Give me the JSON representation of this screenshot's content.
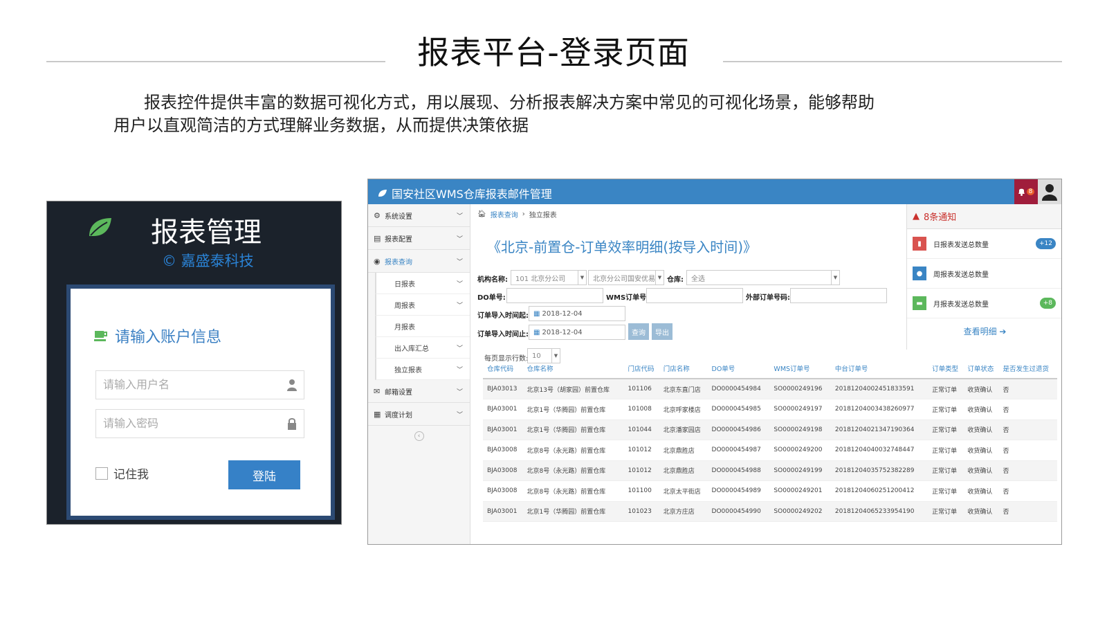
{
  "slide": {
    "title": "报表平台-登录页面",
    "intro_line1": "报表控件提供丰富的数据可视化方式，用以展现、分析报表解决方案中常见的可视化场景，能够帮助",
    "intro_line2": "用户以直观简洁的方式理解业务数据，从而提供决策依据"
  },
  "login": {
    "title": "报表管理",
    "company": "© 嘉盛泰科技",
    "hint": "请输入账户信息",
    "username_placeholder": "请输入用户名",
    "password_placeholder": "请输入密码",
    "remember": "记住我",
    "submit": "登陆",
    "colors": {
      "bg": "#1b222b",
      "accent": "#3681c7",
      "leaf": "#5cb85c"
    }
  },
  "app": {
    "title": "国安社区WMS仓库报表邮件管理",
    "bell_count": "8",
    "sidebar": {
      "items": [
        "系统设置",
        "报表配置",
        "报表查询",
        "邮箱设置",
        "调度计划"
      ],
      "sub_items": [
        "日报表",
        "周报表",
        "月报表",
        "出入库汇总",
        "独立报表"
      ]
    },
    "breadcrumb": {
      "root": "报表查询",
      "sep": "›",
      "current": "独立报表"
    },
    "report_title": "《北京-前置仓-订单效率明细(按导入时间)》",
    "filters": {
      "org_label": "机构名称:",
      "org_value": "101 北京分公司",
      "org_value2": "北京分公司国安优易",
      "warehouse_label": "仓库:",
      "warehouse_value": "全选",
      "do_label": "DO单号:",
      "wms_label": "WMS订单号:",
      "ext_label": "外部订单号码:",
      "start_label": "订单导入时间起:",
      "start_value": "2018-12-04",
      "end_label": "订单导入时间止:",
      "end_value": "2018-12-04",
      "query_btn": "查询",
      "export_btn": "导出",
      "page_size_label": "每页显示行数:",
      "page_size_value": "10"
    },
    "notice": {
      "title": "8条通知",
      "items": [
        {
          "label": "日报表发送总数量",
          "badge": "+12",
          "color": "#d9534f",
          "badge_color": "#3a85c4"
        },
        {
          "label": "周报表发送总数量",
          "badge": "",
          "color": "#3a85c4",
          "badge_color": ""
        },
        {
          "label": "月报表发送总数量",
          "badge": "+8",
          "color": "#5cb85c",
          "badge_color": "#5cb85c"
        }
      ],
      "more": "查看明细 ➔"
    },
    "table": {
      "headers": [
        "仓库代码",
        "仓库名称",
        "门店代码",
        "门店名称",
        "DO单号",
        "WMS订单号",
        "中台订单号",
        "订单类型",
        "订单状态",
        "是否发生过退货"
      ],
      "rows": [
        [
          "BJA03013",
          "北京13号（胡家园）前置仓库",
          "101106",
          "北京东直门店",
          "DO0000454984",
          "SO0000249196",
          "20181204002451833591",
          "正常订单",
          "收货确认",
          "否"
        ],
        [
          "BJA03001",
          "北京1号（华腾园）前置仓库",
          "101008",
          "北京呼家楼店",
          "DO0000454985",
          "SO0000249197",
          "20181204003438260977",
          "正常订单",
          "收货确认",
          "否"
        ],
        [
          "BJA03001",
          "北京1号（华腾园）前置仓库",
          "101044",
          "北京潘家园店",
          "DO0000454986",
          "SO0000249198",
          "20181204021347190364",
          "正常订单",
          "收货确认",
          "否"
        ],
        [
          "BJA03008",
          "北京8号（永光路）前置仓库",
          "101012",
          "北京鼎胜店",
          "DO0000454987",
          "SO0000249200",
          "20181204040032748447",
          "正常订单",
          "收货确认",
          "否"
        ],
        [
          "BJA03008",
          "北京8号（永光路）前置仓库",
          "101012",
          "北京鼎胜店",
          "DO0000454988",
          "SO0000249199",
          "20181204035752382289",
          "正常订单",
          "收货确认",
          "否"
        ],
        [
          "BJA03008",
          "北京8号（永光路）前置仓库",
          "101100",
          "北京太平街店",
          "DO0000454989",
          "SO0000249201",
          "20181204060251200412",
          "正常订单",
          "收货确认",
          "否"
        ],
        [
          "BJA03001",
          "北京1号（华腾园）前置仓库",
          "101023",
          "北京方庄店",
          "DO0000454990",
          "SO0000249202",
          "20181204065233954190",
          "正常订单",
          "收货确认",
          "否"
        ]
      ]
    }
  }
}
